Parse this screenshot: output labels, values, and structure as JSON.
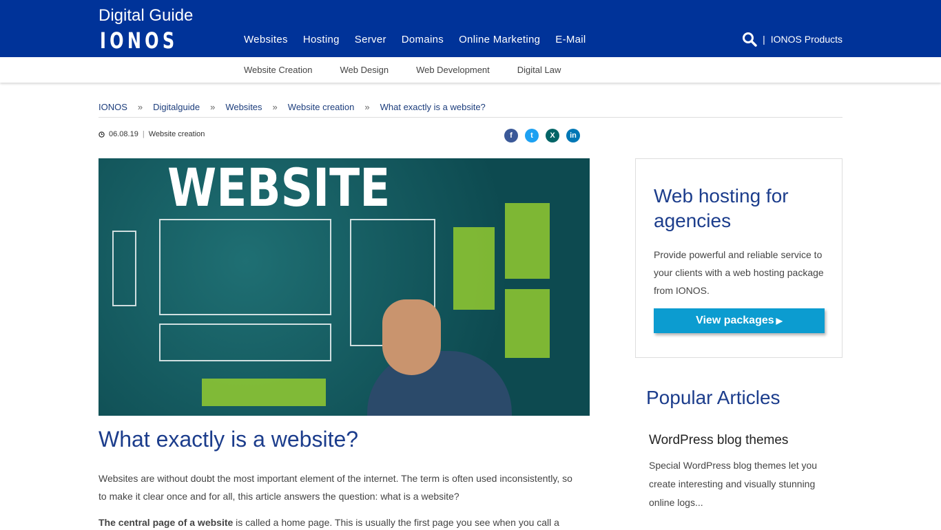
{
  "header": {
    "brand": "Digital Guide",
    "logo": "IONOS",
    "nav": [
      "Websites",
      "Hosting",
      "Server",
      "Domains",
      "Online Marketing",
      "E-Mail"
    ],
    "products": "IONOS Products",
    "separator": "|"
  },
  "subnav": [
    "Website Creation",
    "Web Design",
    "Web Development",
    "Digital Law"
  ],
  "breadcrumb": [
    "IONOS",
    "Digitalguide",
    "Websites",
    "Website creation",
    "What exactly is a website?"
  ],
  "breadcrumb_sep": "»",
  "meta": {
    "date": "06.08.19",
    "category": "Website creation",
    "sep": "|"
  },
  "share": [
    {
      "icon": "facebook-icon",
      "glyph": "f",
      "color": "#3b5998"
    },
    {
      "icon": "twitter-icon",
      "glyph": "t",
      "color": "#1da1f2"
    },
    {
      "icon": "xing-icon",
      "glyph": "X",
      "color": "#026466"
    },
    {
      "icon": "linkedin-icon",
      "glyph": "in",
      "color": "#0077b5"
    }
  ],
  "hero": {
    "text": "WEBSITE"
  },
  "article": {
    "title": "What exactly is a website?",
    "p1": "Websites are without doubt the most important element of the internet. The term is often used inconsistently, so to make it clear once and for all, this article answers the question: what is a website?",
    "p2_bold": "The central page of a website",
    "p2_rest": " is called a home page. This is usually the first page you see when you call a"
  },
  "ad": {
    "title": "Web hosting for agencies",
    "text": "Provide powerful and reliable service to your clients with a web hosting package from IONOS.",
    "button": "View packages"
  },
  "popular": {
    "heading": "Popular Articles",
    "items": [
      {
        "title": "WordPress blog themes",
        "desc": "Special WordPress blog themes let you create interesting and visually stunning online logs..."
      }
    ]
  },
  "colors": {
    "header": "#003399",
    "accent": "#1c3d8c",
    "button": "#0c9cd0"
  }
}
